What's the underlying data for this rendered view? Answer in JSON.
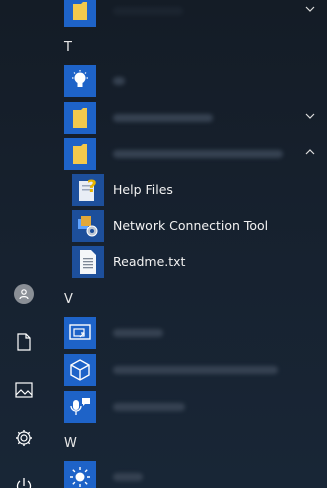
{
  "sections": {
    "t": "T",
    "v": "V",
    "w": "W"
  },
  "subitems": {
    "help_files": "Help Files",
    "network_tool": "Network Connection Tool",
    "readme": "Readme.txt"
  },
  "icons": {
    "rail": [
      "user-icon",
      "document-icon",
      "pictures-icon",
      "settings-icon",
      "power-icon"
    ],
    "accent": "#1e63c8",
    "folder": "#f2c94c"
  }
}
